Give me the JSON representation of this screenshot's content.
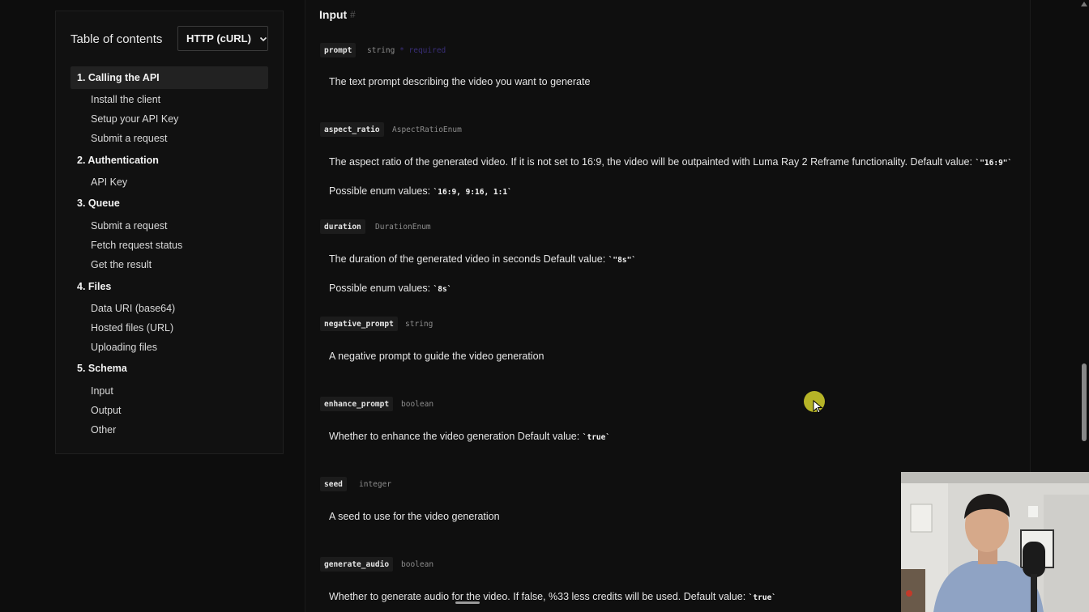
{
  "toc": {
    "title": "Table of contents",
    "language_select": "HTTP (cURL)",
    "sections": [
      {
        "label": "1. Calling the API",
        "active": true,
        "items": [
          "Install the client",
          "Setup your API Key",
          "Submit a request"
        ]
      },
      {
        "label": "2. Authentication",
        "active": false,
        "items": [
          "API Key"
        ]
      },
      {
        "label": "3. Queue",
        "active": false,
        "items": [
          "Submit a request",
          "Fetch request status",
          "Get the result"
        ]
      },
      {
        "label": "4. Files",
        "active": false,
        "items": [
          "Data URI (base64)",
          "Hosted files (URL)",
          "Uploading files"
        ]
      },
      {
        "label": "5. Schema",
        "active": false,
        "items": [
          "Input",
          "Output",
          "Other"
        ]
      }
    ]
  },
  "main": {
    "heading": "Input",
    "heading_hash": "#",
    "params": [
      {
        "name": "prompt",
        "type": "string",
        "required": "* required",
        "description": "The text prompt describing the video you want to generate"
      },
      {
        "name": "aspect_ratio",
        "type": "AspectRatioEnum",
        "description": "The aspect ratio of the generated video. If it is not set to 16:9, the video will be outpainted with Luma Ray 2 Reframe functionality. Default value:",
        "default": "\"16:9\"",
        "enum_label": "Possible enum values:",
        "enum_values": "16:9, 9:16, 1:1"
      },
      {
        "name": "duration",
        "type": "DurationEnum",
        "description": "The duration of the generated video in seconds Default value:",
        "default": "\"8s\"",
        "enum_label": "Possible enum values:",
        "enum_values": "8s"
      },
      {
        "name": "negative_prompt",
        "type": "string",
        "description": "A negative prompt to guide the video generation"
      },
      {
        "name": "enhance_prompt",
        "type": "boolean",
        "description": "Whether to enhance the video generation Default value:",
        "default": "true"
      },
      {
        "name": "seed",
        "type": "integer",
        "description": "A seed to use for the video generation"
      },
      {
        "name": "generate_audio",
        "type": "boolean",
        "description": "Whether to generate audio for the video. If false, %33 less credits will be used. Default value:",
        "default": "true"
      }
    ]
  },
  "colors": {
    "page_bg": "#0d0d0d",
    "panel_bg": "#111111",
    "active_item_bg": "#222222",
    "required_text": "#3a2f7a",
    "cursor_highlight": "#c9c72a"
  },
  "icons": [
    "chevron-down-icon",
    "cursor-icon",
    "scroll-up-arrow-icon"
  ]
}
